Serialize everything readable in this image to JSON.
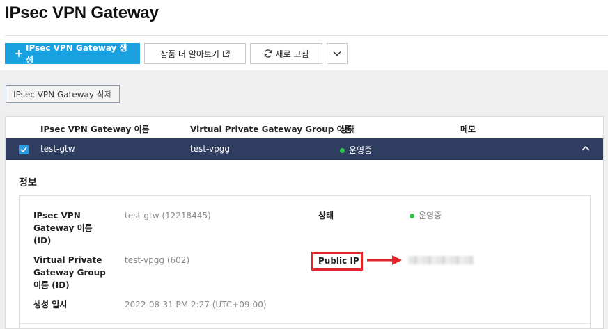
{
  "page": {
    "title": "IPsec VPN Gateway"
  },
  "toolbar": {
    "create_label": "IPsec VPN Gateway 생성",
    "learn_more_label": "상품 더 알아보기",
    "refresh_label": "새로 고침",
    "more_icon": "chevron-down-icon"
  },
  "actions": {
    "delete_label": "IPsec VPN Gateway 삭제"
  },
  "table": {
    "headers": [
      "IPsec VPN Gateway 이름",
      "Virtual Private Gateway Group 이름",
      "상태",
      "메모"
    ],
    "rows": [
      {
        "name": "test-gtw",
        "vpg_group": "test-vpgg",
        "status": "운영중",
        "memo": "",
        "selected": true
      }
    ]
  },
  "detail": {
    "section_title": "정보",
    "fields": {
      "gateway_name_label": [
        "IPsec VPN",
        "Gateway 이름",
        "(ID)"
      ],
      "gateway_name_value": "test-gtw (12218445)",
      "vpg_group_label": [
        "Virtual Private",
        "Gateway Group",
        "이름 (ID)"
      ],
      "vpg_group_value": "test-vpgg (602)",
      "created_label": "생성 일시",
      "created_value": "2022-08-31 PM 2:27 (UTC+09:00)",
      "status_label": "상태",
      "status_value": "운영중",
      "public_ip_label": "Public IP",
      "public_ip_value_note": "blurred"
    }
  },
  "colors": {
    "primary": "#1aa1e0",
    "selected_row": "#2f3d61",
    "status_running": "#31c44e",
    "annotation_red": "#e0262b"
  }
}
